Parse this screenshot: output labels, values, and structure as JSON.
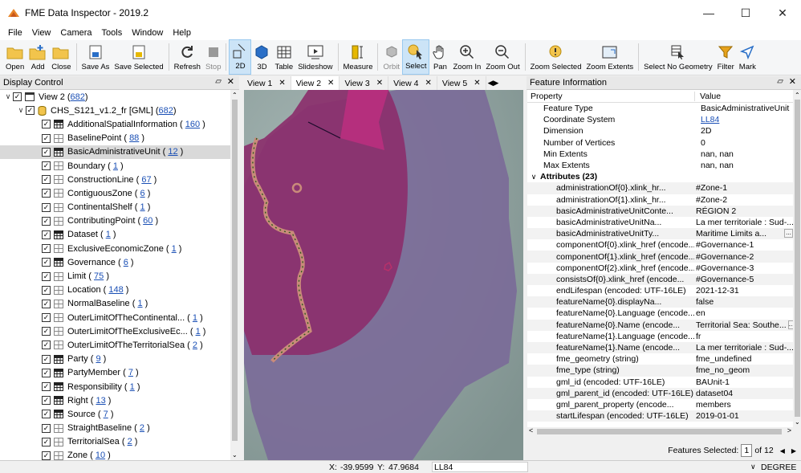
{
  "window": {
    "title": "FME Data Inspector - 2019.2"
  },
  "menu": [
    "File",
    "View",
    "Camera",
    "Tools",
    "Window",
    "Help"
  ],
  "toolbar": [
    {
      "id": "open",
      "label": "Open",
      "icon": "folder-open-icon"
    },
    {
      "id": "add",
      "label": "Add",
      "icon": "add-dataset-icon"
    },
    {
      "id": "close",
      "label": "Close",
      "icon": "folder-close-icon"
    },
    {
      "id": "saveas",
      "label": "Save As",
      "icon": "save-as-icon"
    },
    {
      "id": "savesel",
      "label": "Save Selected",
      "icon": "save-selected-icon"
    },
    {
      "id": "refresh",
      "label": "Refresh",
      "icon": "refresh-icon"
    },
    {
      "id": "stop",
      "label": "Stop",
      "icon": "stop-icon"
    },
    {
      "id": "2d",
      "label": "2D",
      "icon": "2d-view-icon"
    },
    {
      "id": "3d",
      "label": "3D",
      "icon": "3d-view-icon"
    },
    {
      "id": "table",
      "label": "Table",
      "icon": "table-icon"
    },
    {
      "id": "slideshow",
      "label": "Slideshow",
      "icon": "slideshow-icon"
    },
    {
      "id": "measure",
      "label": "Measure",
      "icon": "measure-icon"
    },
    {
      "id": "orbit",
      "label": "Orbit",
      "icon": "orbit-icon"
    },
    {
      "id": "select",
      "label": "Select",
      "icon": "select-icon"
    },
    {
      "id": "pan",
      "label": "Pan",
      "icon": "pan-hand-icon"
    },
    {
      "id": "zoomin",
      "label": "Zoom In",
      "icon": "zoom-in-icon"
    },
    {
      "id": "zoomout",
      "label": "Zoom Out",
      "icon": "zoom-out-icon"
    },
    {
      "id": "zoomsel",
      "label": "Zoom Selected",
      "icon": "zoom-selected-icon"
    },
    {
      "id": "zoomext",
      "label": "Zoom Extents",
      "icon": "zoom-extents-icon"
    },
    {
      "id": "selnogeom",
      "label": "Select No Geometry",
      "icon": "select-no-geometry-icon"
    },
    {
      "id": "filter",
      "label": "Filter",
      "icon": "filter-icon"
    },
    {
      "id": "mark",
      "label": "Mark",
      "icon": "mark-icon"
    }
  ],
  "display_control": {
    "title": "Display Control",
    "root": {
      "label": "View 2 (",
      "count": "682",
      "suffix": ")"
    },
    "dataset": {
      "label": "CHS_S121_v1.2_fr [GML] (",
      "count": "682",
      "suffix": ")"
    },
    "items": [
      {
        "name": "AdditionalSpatialInformation",
        "count": "160",
        "icon": "table"
      },
      {
        "name": "BaselinePoint",
        "count": "88",
        "icon": "grid"
      },
      {
        "name": "BasicAdministrativeUnit",
        "count": "12",
        "icon": "table",
        "selected": true
      },
      {
        "name": "Boundary",
        "count": "1",
        "icon": "grid"
      },
      {
        "name": "ConstructionLine",
        "count": "67",
        "icon": "grid"
      },
      {
        "name": "ContiguousZone",
        "count": "6",
        "icon": "grid"
      },
      {
        "name": "ContinentalShelf",
        "count": "1",
        "icon": "grid"
      },
      {
        "name": "ContributingPoint",
        "count": "60",
        "icon": "grid"
      },
      {
        "name": "Dataset",
        "count": "1",
        "icon": "table"
      },
      {
        "name": "ExclusiveEconomicZone",
        "count": "1",
        "icon": "grid"
      },
      {
        "name": "Governance",
        "count": "6",
        "icon": "table"
      },
      {
        "name": "Limit",
        "count": "75",
        "icon": "grid"
      },
      {
        "name": "Location",
        "count": "148",
        "icon": "grid"
      },
      {
        "name": "NormalBaseline",
        "count": "1",
        "icon": "grid"
      },
      {
        "name": "OuterLimitOfTheContinental...",
        "count": "1",
        "icon": "grid"
      },
      {
        "name": "OuterLimitOfTheExclusiveEc...",
        "count": "1",
        "icon": "grid"
      },
      {
        "name": "OuterLimitOfTheTerritorialSea",
        "count": "2",
        "icon": "grid"
      },
      {
        "name": "Party",
        "count": "9",
        "icon": "table"
      },
      {
        "name": "PartyMember",
        "count": "7",
        "icon": "table"
      },
      {
        "name": "Responsibility",
        "count": "1",
        "icon": "table"
      },
      {
        "name": "Right",
        "count": "13",
        "icon": "table"
      },
      {
        "name": "Source",
        "count": "7",
        "icon": "table"
      },
      {
        "name": "StraightBaseline",
        "count": "2",
        "icon": "grid"
      },
      {
        "name": "TerritorialSea",
        "count": "2",
        "icon": "grid"
      },
      {
        "name": "Zone",
        "count": "10",
        "icon": "grid"
      }
    ]
  },
  "view_tabs": [
    "View 1",
    "View 2",
    "View 3",
    "View 4",
    "View 5"
  ],
  "active_tab": "View 2",
  "feature_info": {
    "title": "Feature Information",
    "headers": {
      "property": "Property",
      "value": "Value"
    },
    "rows": [
      {
        "p": "Feature Type",
        "v": "BasicAdministrativeUnit"
      },
      {
        "p": "Coordinate System",
        "v": "LL84",
        "link": true
      },
      {
        "p": "Dimension",
        "v": "2D"
      },
      {
        "p": "Number of Vertices",
        "v": "0"
      },
      {
        "p": "Min Extents",
        "v": "nan, nan"
      },
      {
        "p": "Max Extents",
        "v": "nan, nan"
      }
    ],
    "attributes_label": "Attributes (23)",
    "attributes": [
      {
        "p": "administrationOf{0}.xlink_hr...",
        "v": "#Zone-1"
      },
      {
        "p": "administrationOf{1}.xlink_hr...",
        "v": "#Zone-2"
      },
      {
        "p": "basicAdministrativeUnitConte...",
        "v": "RÉGION 2"
      },
      {
        "p": "basicAdministrativeUnitNa...",
        "v": "La mer territoriale : Sud-...",
        "more": true
      },
      {
        "p": "basicAdministrativeUnitTy...",
        "v": "Maritime Limits a...",
        "more": true
      },
      {
        "p": "componentOf{0}.xlink_href (encode...",
        "v": "#Governance-1"
      },
      {
        "p": "componentOf{1}.xlink_href (encode...",
        "v": "#Governance-2"
      },
      {
        "p": "componentOf{2}.xlink_href (encode...",
        "v": "#Governance-3"
      },
      {
        "p": "consistsOf{0}.xlink_href (encode...",
        "v": "#Governance-5"
      },
      {
        "p": "endLifespan (encoded: UTF-16LE)",
        "v": "2021-12-31"
      },
      {
        "p": "featureName{0}.displayNa...",
        "v": "false"
      },
      {
        "p": "featureName{0}.Language (encode...",
        "v": "en"
      },
      {
        "p": "featureName{0}.Name (encode...",
        "v": "Territorial Sea: Southe...",
        "more": true
      },
      {
        "p": "featureName{1}.Language (encode...",
        "v": "fr"
      },
      {
        "p": "featureName{1}.Name (encode...",
        "v": "La mer territoriale : Sud-...",
        "more": true
      },
      {
        "p": "fme_geometry (string)",
        "v": "fme_undefined"
      },
      {
        "p": "fme_type (string)",
        "v": "fme_no_geom"
      },
      {
        "p": "gml_id (encoded: UTF-16LE)",
        "v": "BAUnit-1"
      },
      {
        "p": "gml_parent_id (encoded: UTF-16LE)",
        "v": "dataset04"
      },
      {
        "p": "gml_parent_property (encode...",
        "v": "members"
      },
      {
        "p": "startLifespan (encoded: UTF-16LE)",
        "v": "2019-01-01"
      }
    ],
    "features_selected_label": "Features Selected:",
    "features_selected_index": "1",
    "features_selected_total": "of 12"
  },
  "status": {
    "x_label": "X:",
    "x": "-39.9599",
    "y_label": "Y:",
    "y": "47.9684",
    "cs": "LL84",
    "units": "DEGREE"
  }
}
